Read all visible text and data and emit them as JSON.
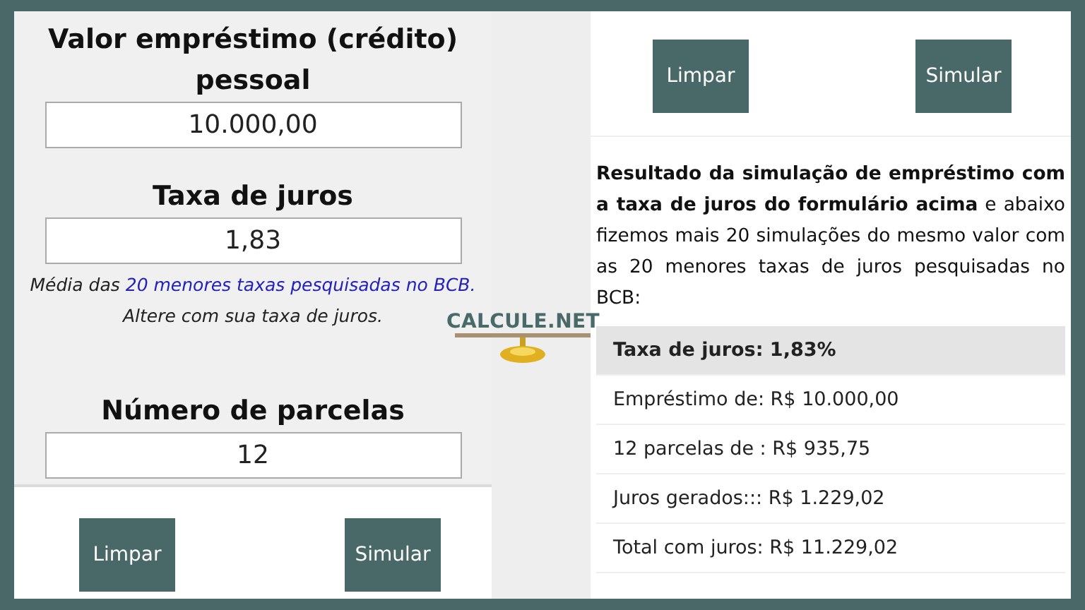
{
  "form": {
    "fields": [
      {
        "label": "Valor empréstimo (crédito) pessoal",
        "value": "10.000,00"
      },
      {
        "label": "Taxa de juros",
        "value": "1,83",
        "note": {
          "prefix": "Média das",
          "link": "20 menores taxas pesquisadas no BCB.",
          "second_line": "Altere com sua taxa de juros."
        }
      },
      {
        "label": "Número de parcelas",
        "value": "12"
      }
    ],
    "buttons": [
      "Limpar",
      "Simular"
    ]
  },
  "logo": {
    "text": "CALCULE.NET"
  },
  "result": {
    "buttons": [
      "Limpar",
      "Simular"
    ],
    "intro": "**Resultado da simulação de empréstimo com a taxa de juros do formulário acima** e abaixo fizemos mais 20 simulações do mesmo valor com as 20 menores taxas de juros pesquisadas no BCB:",
    "rows": [
      {
        "kind": "header",
        "text": "Taxa de juros: 1,83%"
      },
      {
        "kind": "line",
        "text": "Empréstimo de: R$ 10.000,00"
      },
      {
        "kind": "line",
        "text": "12 parcelas de : R$ 935,75"
      },
      {
        "kind": "line",
        "text": "Juros gerados::: R$ 1.229,02"
      },
      {
        "kind": "line",
        "text": "Total com juros: R$ 11.229,02"
      }
    ]
  }
}
